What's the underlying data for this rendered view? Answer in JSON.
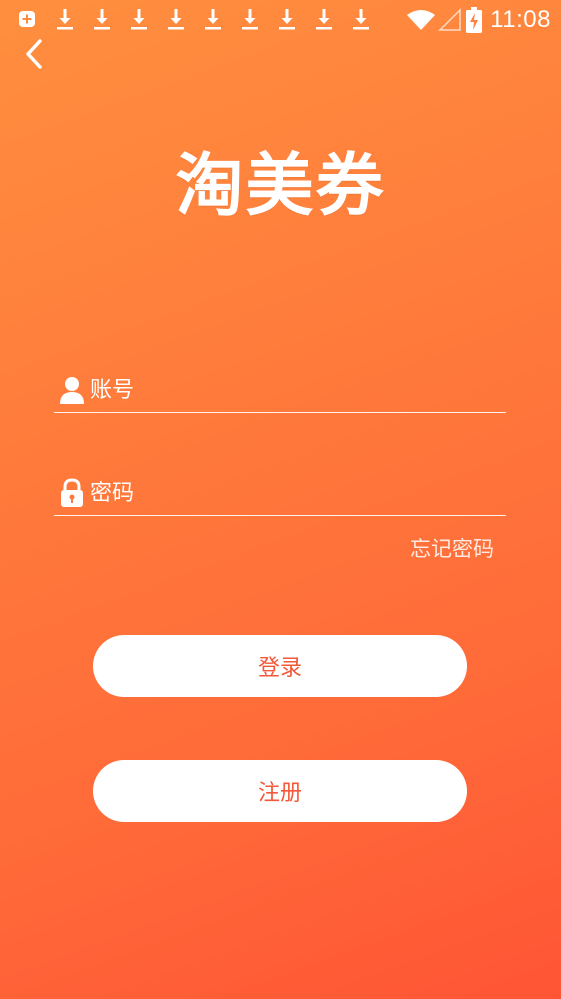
{
  "status_bar": {
    "time": "11:08",
    "icons": [
      "notification-add-icon",
      "download-icon",
      "download-icon",
      "download-icon",
      "download-icon",
      "download-icon",
      "download-icon",
      "download-icon",
      "download-icon",
      "download-icon",
      "wifi-icon",
      "signal-icon",
      "battery-charging-icon"
    ]
  },
  "header": {
    "back_icon": "chevron-left-icon"
  },
  "logo": {
    "title": "淘美券"
  },
  "form": {
    "account_placeholder": "账号",
    "account_value": "",
    "account_icon": "user-icon",
    "password_placeholder": "密码",
    "password_value": "",
    "password_icon": "lock-icon",
    "forgot_label": "忘记密码"
  },
  "actions": {
    "login_label": "登录",
    "register_label": "注册"
  },
  "colors": {
    "gradient_start": "#ff8f3f",
    "gradient_end": "#ff5535",
    "button_text": "#f4583a",
    "button_bg": "#ffffff"
  }
}
